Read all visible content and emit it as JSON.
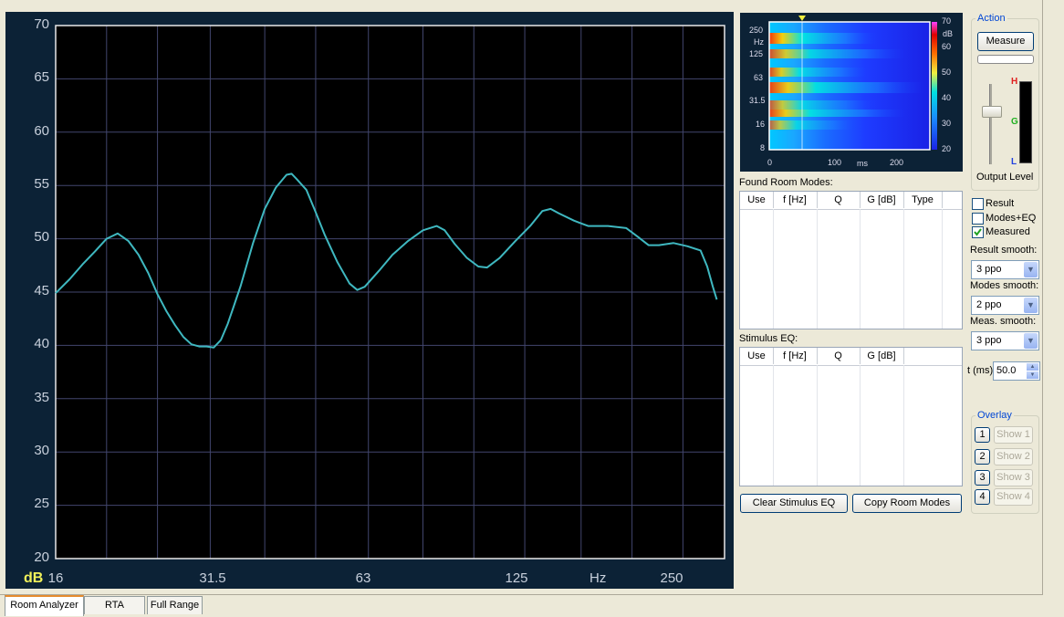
{
  "graph": {
    "y_ticks": [
      "70",
      "65",
      "60",
      "55",
      "50",
      "45",
      "40",
      "35",
      "30",
      "25",
      "20"
    ],
    "x_ticks": [
      "16",
      "31.5",
      "63",
      "125",
      "250"
    ],
    "db_label": "dB",
    "hz_label": "Hz"
  },
  "chart_data": {
    "type": "line",
    "xscale": "log",
    "xlim": [
      16,
      300
    ],
    "ylim": [
      20,
      70
    ],
    "xlabel": "Hz",
    "ylabel": "dB",
    "grid": true,
    "series": [
      {
        "color": "#3fb8c0",
        "points": [
          [
            16,
            44.9
          ],
          [
            17,
            46.2
          ],
          [
            18,
            47.6
          ],
          [
            19,
            48.8
          ],
          [
            20,
            50.0
          ],
          [
            21,
            50.5
          ],
          [
            22,
            49.8
          ],
          [
            23,
            48.5
          ],
          [
            24,
            46.8
          ],
          [
            25,
            44.8
          ],
          [
            26,
            43.2
          ],
          [
            27,
            41.9
          ],
          [
            28,
            40.8
          ],
          [
            29,
            40.1
          ],
          [
            30,
            39.9
          ],
          [
            31,
            39.9
          ],
          [
            32,
            39.8
          ],
          [
            33,
            40.5
          ],
          [
            34,
            42.0
          ],
          [
            35,
            43.8
          ],
          [
            36,
            45.6
          ],
          [
            38,
            49.6
          ],
          [
            40,
            52.8
          ],
          [
            42,
            54.8
          ],
          [
            44,
            56.0
          ],
          [
            45,
            56.1
          ],
          [
            46,
            55.6
          ],
          [
            48,
            54.6
          ],
          [
            50,
            52.5
          ],
          [
            52,
            50.4
          ],
          [
            55,
            47.8
          ],
          [
            58,
            45.8
          ],
          [
            60,
            45.2
          ],
          [
            62,
            45.5
          ],
          [
            66,
            47.0
          ],
          [
            70,
            48.5
          ],
          [
            75,
            49.8
          ],
          [
            80,
            50.8
          ],
          [
            85,
            51.2
          ],
          [
            88,
            50.8
          ],
          [
            92,
            49.5
          ],
          [
            97,
            48.2
          ],
          [
            102,
            47.4
          ],
          [
            106,
            47.3
          ],
          [
            112,
            48.2
          ],
          [
            120,
            49.8
          ],
          [
            128,
            51.2
          ],
          [
            135,
            52.6
          ],
          [
            140,
            52.8
          ],
          [
            145,
            52.4
          ],
          [
            155,
            51.7
          ],
          [
            165,
            51.2
          ],
          [
            180,
            51.2
          ],
          [
            195,
            51.0
          ],
          [
            205,
            50.2
          ],
          [
            215,
            49.4
          ],
          [
            225,
            49.4
          ],
          [
            240,
            49.6
          ],
          [
            255,
            49.3
          ],
          [
            270,
            48.9
          ],
          [
            278,
            47.4
          ],
          [
            285,
            45.5
          ],
          [
            290,
            44.3
          ]
        ]
      }
    ]
  },
  "spectrogram": {
    "y_ticks": [
      "250",
      "Hz",
      "125",
      "63",
      "31.5",
      "16",
      "8"
    ],
    "x_ticks": [
      "0",
      "100",
      "ms",
      "200"
    ],
    "scale_ticks": [
      "70",
      "dB",
      "60",
      "50",
      "40",
      "30",
      "20"
    ]
  },
  "room_modes": {
    "label": "Found Room Modes:",
    "columns": [
      "Use",
      "f [Hz]",
      "Q",
      "G [dB]",
      "Type"
    ]
  },
  "stimulus_eq": {
    "label": "Stimulus EQ:",
    "columns": [
      "Use",
      "f [Hz]",
      "Q",
      "G [dB]"
    ]
  },
  "buttons": {
    "clear_eq": "Clear Stimulus EQ",
    "copy_modes": "Copy Room Modes",
    "measure": "Measure"
  },
  "action": {
    "title": "Action",
    "output_level": "Output Level",
    "meter": {
      "h": "H",
      "g": "G",
      "l": "L"
    }
  },
  "checkboxes": [
    {
      "label": "Result",
      "checked": false
    },
    {
      "label": "Modes+EQ",
      "checked": false
    },
    {
      "label": "Measured",
      "checked": true
    }
  ],
  "smoothing": {
    "result_label": "Result smooth:",
    "result_value": "3 ppo",
    "modes_label": "Modes smooth:",
    "modes_value": "2 ppo",
    "meas_label": "Meas. smooth:",
    "meas_value": "3 ppo",
    "t_label": "t (ms)",
    "t_value": "50.0"
  },
  "overlay": {
    "title": "Overlay",
    "items": [
      {
        "num": "1",
        "show": "Show 1"
      },
      {
        "num": "2",
        "show": "Show 2"
      },
      {
        "num": "3",
        "show": "Show 3"
      },
      {
        "num": "4",
        "show": "Show 4"
      }
    ]
  },
  "tabs": [
    "Room Analyzer",
    "RTA",
    "Full Range"
  ],
  "colors": {
    "curve": "#3fb8c0",
    "grid": "#42466e",
    "plot_bg": "#000000",
    "panel_bg": "#0c2236",
    "db_label": "#f2f25a"
  }
}
